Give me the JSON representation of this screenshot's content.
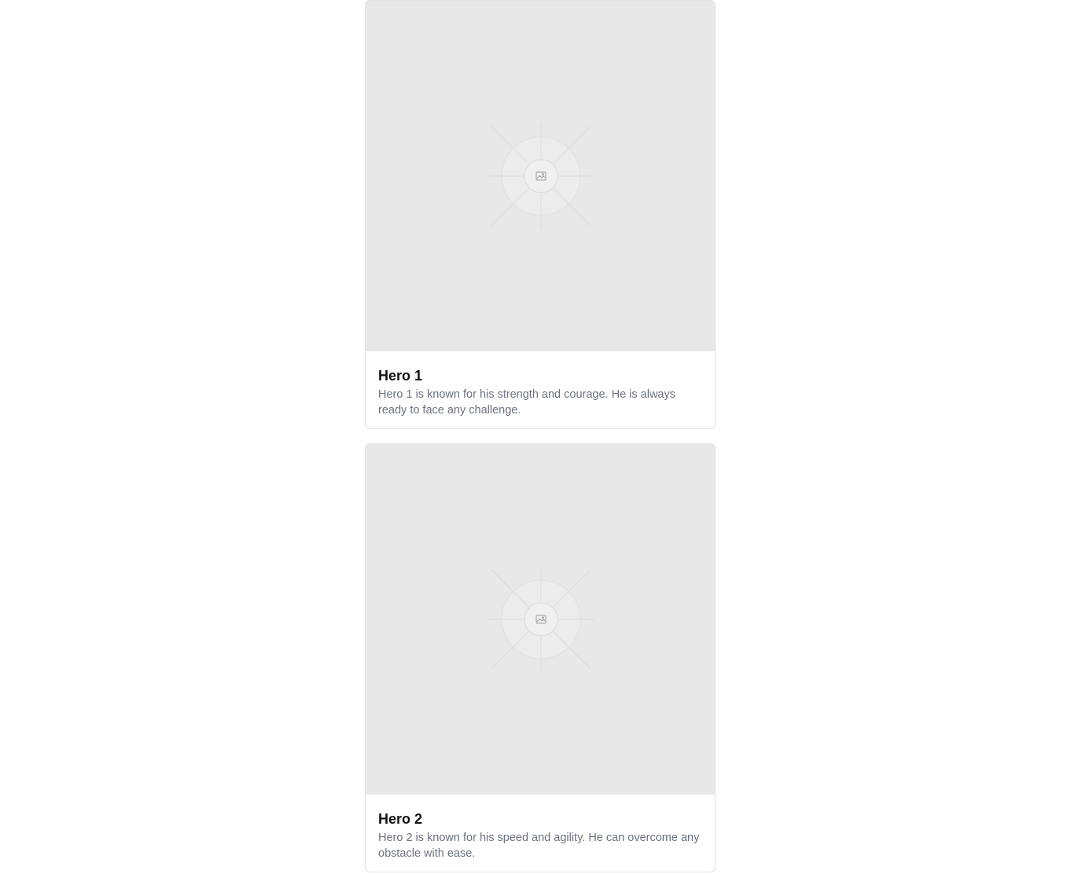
{
  "cards": [
    {
      "title": "Hero 1",
      "description": "Hero 1 is known for his strength and courage. He is always ready to face any challenge.",
      "image_icon": "image-placeholder-icon"
    },
    {
      "title": "Hero 2",
      "description": "Hero 2 is known for his speed and agility. He can overcome any obstacle with ease.",
      "image_icon": "image-placeholder-icon"
    }
  ],
  "colors": {
    "placeholder_bg": "#e8e8e8",
    "title_text": "#111111",
    "description_text": "#6b7280",
    "card_border": "#e2e4e8"
  }
}
